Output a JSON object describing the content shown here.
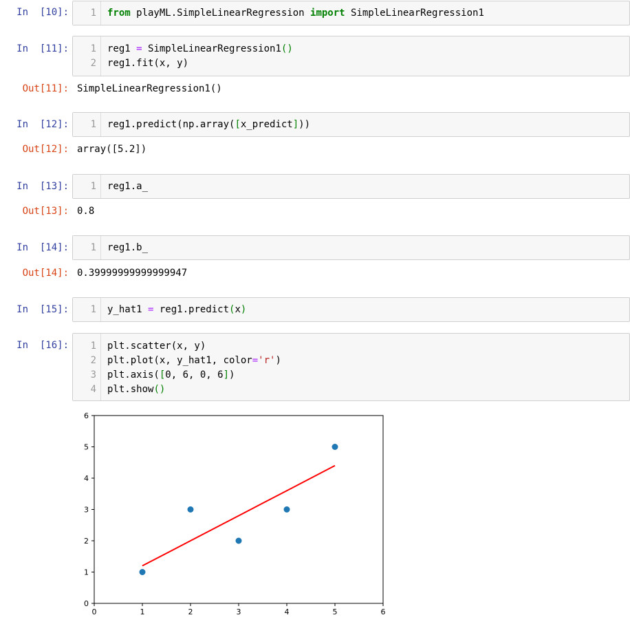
{
  "cells": [
    {
      "prompt": "In  [10]:",
      "lines": [
        "1"
      ],
      "code": [
        "from playML.SimpleLinearRegression import SimpleLinearRegression1"
      ]
    },
    {
      "prompt": "In  [11]:",
      "lines": [
        "1",
        "2"
      ],
      "code": [
        "reg1 = SimpleLinearRegression1()",
        "reg1.fit(x, y)"
      ],
      "out_prompt": "Out[11]:",
      "output": "SimpleLinearRegression1()"
    },
    {
      "prompt": "In  [12]:",
      "lines": [
        "1"
      ],
      "code": [
        "reg1.predict(np.array([x_predict]))"
      ],
      "out_prompt": "Out[12]:",
      "output": "array([5.2])"
    },
    {
      "prompt": "In  [13]:",
      "lines": [
        "1"
      ],
      "code": [
        "reg1.a_"
      ],
      "out_prompt": "Out[13]:",
      "output": "0.8"
    },
    {
      "prompt": "In  [14]:",
      "lines": [
        "1"
      ],
      "code": [
        "reg1.b_"
      ],
      "out_prompt": "Out[14]:",
      "output": "0.39999999999999947"
    },
    {
      "prompt": "In  [15]:",
      "lines": [
        "1"
      ],
      "code": [
        "y_hat1 = reg1.predict(x)"
      ]
    },
    {
      "prompt": "In  [16]:",
      "lines": [
        "1",
        "2",
        "3",
        "4"
      ],
      "code": [
        "plt.scatter(x, y)",
        "plt.plot(x, y_hat1, color='r')",
        "plt.axis([0, 6, 0, 6])",
        "plt.show()"
      ]
    }
  ],
  "chart_data": {
    "type": "scatter",
    "title": "",
    "xlabel": "",
    "ylabel": "",
    "xlim": [
      0,
      6
    ],
    "ylim": [
      0,
      6
    ],
    "xticks": [
      "0",
      "1",
      "2",
      "3",
      "4",
      "5",
      "6"
    ],
    "yticks": [
      "0",
      "1",
      "2",
      "3",
      "4",
      "5",
      "6"
    ],
    "grid": false,
    "series": [
      {
        "kind": "scatter",
        "color": "#1f77b4",
        "x": [
          1,
          2,
          3,
          4,
          5
        ],
        "y": [
          1,
          3,
          2,
          3,
          5
        ]
      },
      {
        "kind": "line",
        "color": "#ff0000",
        "x": [
          1,
          2,
          3,
          4,
          5
        ],
        "y": [
          1.2,
          2.0,
          2.8,
          3.6,
          4.4
        ]
      }
    ]
  }
}
